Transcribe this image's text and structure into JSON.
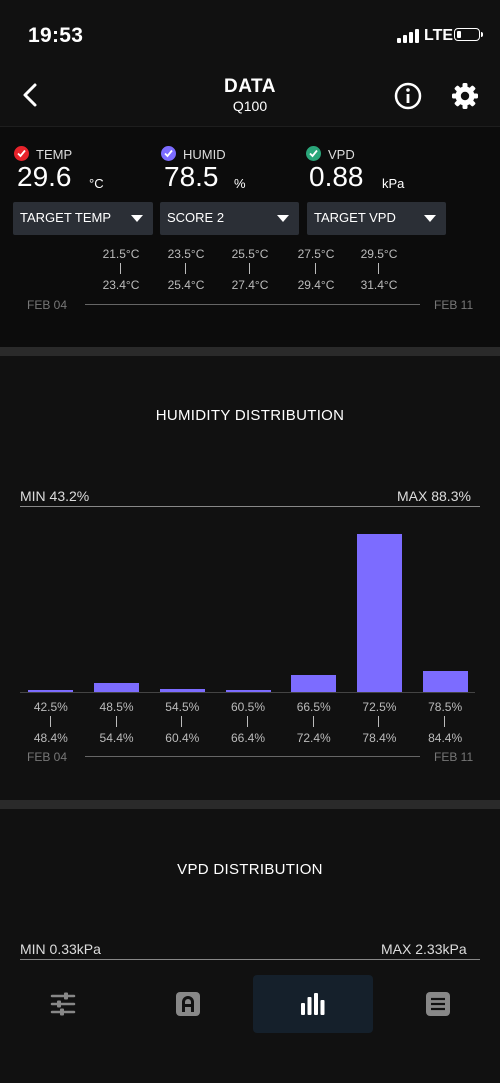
{
  "status_bar": {
    "time": "19:53",
    "network": "LTE",
    "battery_level": 0.2
  },
  "header": {
    "title": "DATA",
    "subtitle": "Q100"
  },
  "metrics": [
    {
      "label": "TEMP",
      "value": "29.6",
      "unit": "°C",
      "color": "#e8232b"
    },
    {
      "label": "HUMID",
      "value": "78.5",
      "unit": "%",
      "color": "#7c6cff"
    },
    {
      "label": "VPD",
      "value": "0.88",
      "unit": "kPa",
      "color": "#2aa67a"
    }
  ],
  "dropdowns": [
    {
      "label": "TARGET TEMP"
    },
    {
      "label": "SCORE 2"
    },
    {
      "label": "TARGET VPD"
    }
  ],
  "temp_ranges": [
    {
      "from": "21.5°C",
      "to": "23.4°C"
    },
    {
      "from": "23.5°C",
      "to": "25.4°C"
    },
    {
      "from": "25.5°C",
      "to": "27.4°C"
    },
    {
      "from": "27.5°C",
      "to": "29.4°C"
    },
    {
      "from": "29.5°C",
      "to": "31.4°C"
    }
  ],
  "date_range": {
    "start": "FEB 04",
    "end": "FEB 11"
  },
  "humidity": {
    "title": "HUMIDITY DISTRIBUTION",
    "min": "MIN 43.2%",
    "max": "MAX 88.3%",
    "date_start": "FEB 04",
    "date_end": "FEB 11"
  },
  "chart_data": {
    "type": "bar",
    "title": "HUMIDITY DISTRIBUTION",
    "bins": [
      {
        "from": "42.5%",
        "to": "48.4%",
        "value": 1
      },
      {
        "from": "48.5%",
        "to": "54.4%",
        "value": 6
      },
      {
        "from": "54.5%",
        "to": "60.4%",
        "value": 2
      },
      {
        "from": "60.5%",
        "to": "66.4%",
        "value": 1
      },
      {
        "from": "66.5%",
        "to": "72.4%",
        "value": 11
      },
      {
        "from": "72.5%",
        "to": "78.4%",
        "value": 100
      },
      {
        "from": "78.5%",
        "to": "84.4%",
        "value": 13
      }
    ],
    "color": "#7c6cff"
  },
  "vpd": {
    "title": "VPD DISTRIBUTION",
    "min": "MIN 0.33kPa",
    "max": "MAX 2.33kPa"
  },
  "bottom_nav": [
    {
      "icon": "sliders-icon",
      "active": false
    },
    {
      "icon": "controller-icon",
      "active": false
    },
    {
      "icon": "bar-chart-icon",
      "active": true
    },
    {
      "icon": "menu-icon",
      "active": false
    }
  ]
}
